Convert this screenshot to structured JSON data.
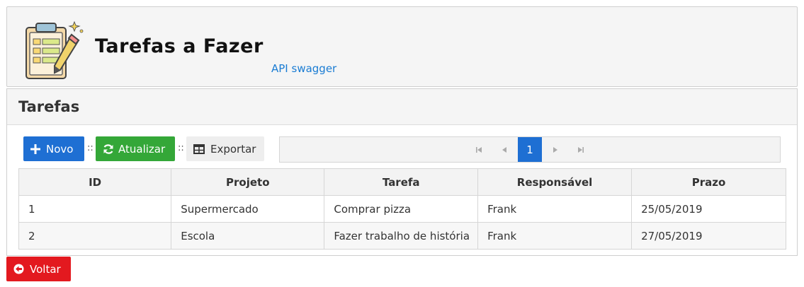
{
  "header": {
    "title": "Tarefas a Fazer",
    "api_link": "API swagger",
    "logo_icon": "clipboard-pencil-icon"
  },
  "panel": {
    "title": "Tarefas"
  },
  "toolbar": {
    "novo_label": "Novo",
    "atualizar_label": "Atualizar",
    "exportar_label": "Exportar",
    "separator": "::"
  },
  "pager": {
    "current_page": "1"
  },
  "table": {
    "columns": [
      "ID",
      "Projeto",
      "Tarefa",
      "Responsável",
      "Prazo"
    ],
    "rows": [
      [
        "1",
        "Supermercado",
        "Comprar pizza",
        "Frank",
        "25/05/2019"
      ],
      [
        "2",
        "Escola",
        "Fazer trabalho de história",
        "Frank",
        "27/05/2019"
      ]
    ]
  },
  "footer": {
    "voltar_label": "Voltar"
  },
  "colors": {
    "primary": "#1e6fd3",
    "success": "#34a738",
    "danger": "#e3191f",
    "link": "#1a7cd3"
  }
}
